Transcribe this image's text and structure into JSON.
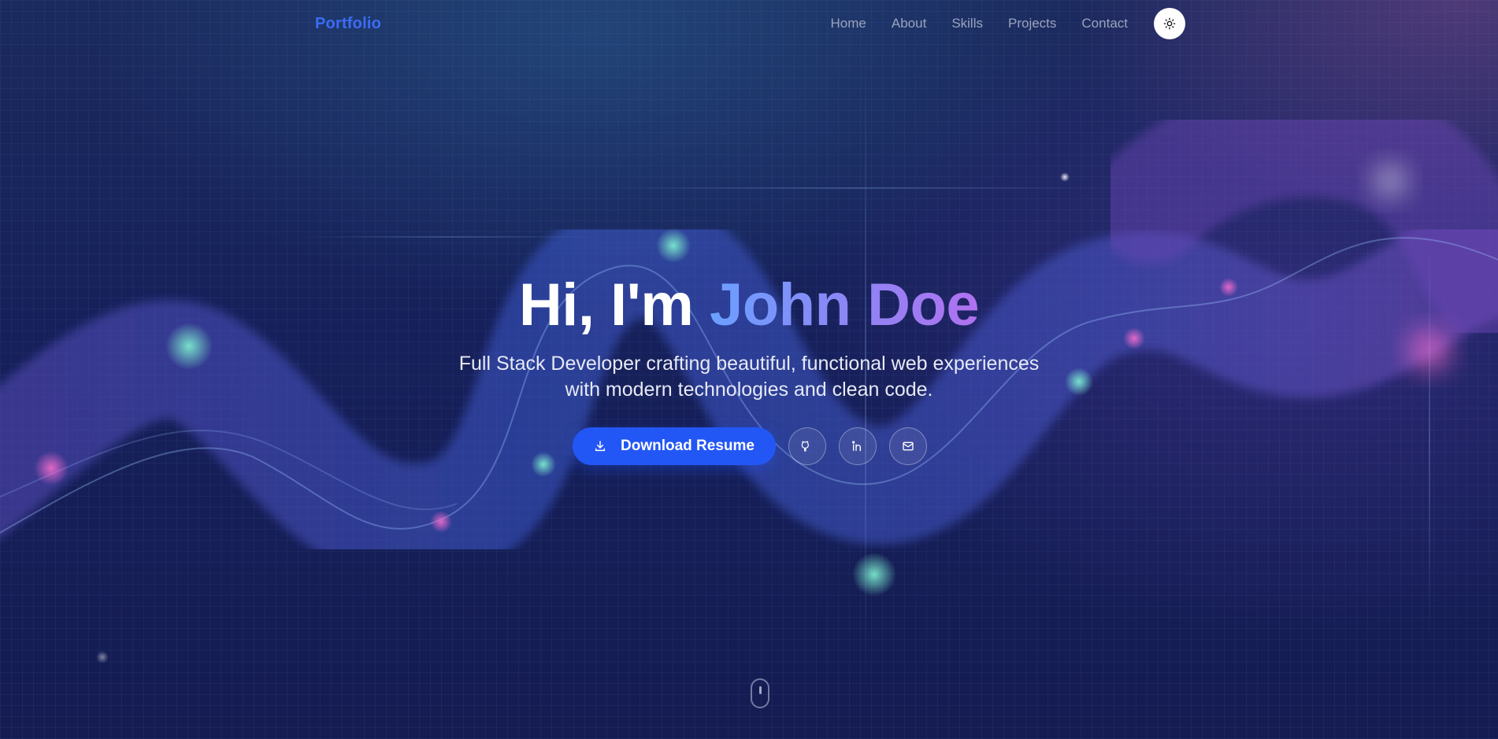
{
  "nav": {
    "brand": "Portfolio",
    "links": [
      {
        "label": "Home"
      },
      {
        "label": "About"
      },
      {
        "label": "Skills"
      },
      {
        "label": "Projects"
      },
      {
        "label": "Contact"
      }
    ],
    "theme_toggle_icon": "sun-icon"
  },
  "hero": {
    "greeting": "Hi, I'm",
    "name": "John Doe",
    "subtitle_line1": "Full Stack Developer crafting beautiful, functional web experiences",
    "subtitle_line2": "with modern technologies and clean code.",
    "download_label": "Download Resume",
    "download_icon": "download-icon",
    "social_icons": [
      "github-icon",
      "linkedin-icon",
      "mail-icon"
    ],
    "scroll_icon": "mouse-scroll-icon"
  },
  "colors": {
    "accent": "#2357f5",
    "brand": "#3b6cf7",
    "gradient_start": "#6ba0ff",
    "gradient_end": "#b071f0"
  }
}
